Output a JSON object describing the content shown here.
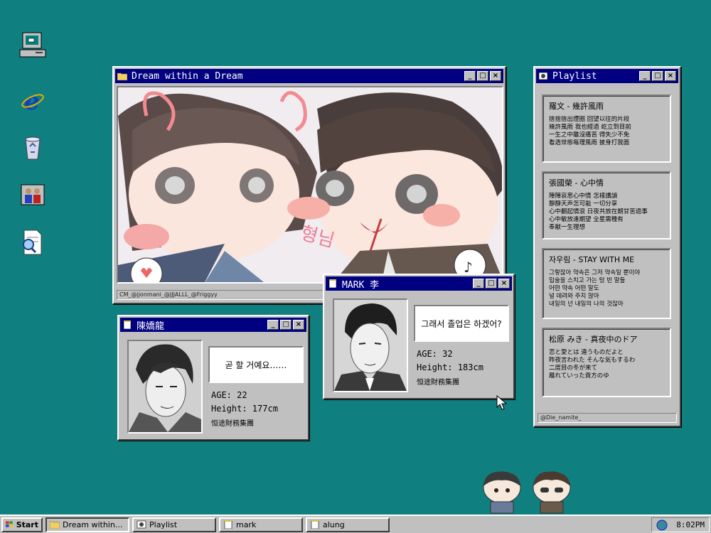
{
  "windows": {
    "dream": {
      "title": "Dream within a Dream",
      "status": "CM_@jjonmani_@JJJALLL_@Friggyy",
      "art_text": "형님"
    },
    "playlist": {
      "title": "Playlist",
      "status": "@Die_namite_",
      "songs": [
        {
          "title": "羅文 - 幾許風雨",
          "lyrics": [
            "捨捨捨出煙圈  回望以往的片段",
            "幾許風雨  我也經過  屹立到目前",
            "一生之中雖沒痛苦  得失少不免",
            "看透世態每理風雨  披身打我面"
          ]
        },
        {
          "title": "張國榮 - 心中情",
          "lyrics": [
            "陣陣哀思心中情  怎樣講讀",
            "靜靜天声怎可能  一切分享",
            "心中翻起情浪  日夜共放在期甘苦過事",
            "心中敏放逢期望  全星需種有",
            "奉献一生理想"
          ]
        },
        {
          "title": "자우림 - STAY WITH ME",
          "lyrics": [
            "그렇잖아 약속은 그저 약속일 뿐이야",
            "입술을 스치고 가는 텅 빈 말들",
            "어떤 약속 어떤 말도",
            "널 데려와 주지 않아",
            "내일의 넌 내일의 나의 것잖아"
          ]
        },
        {
          "title": "松原 みき - 真夜中のドア",
          "lyrics": [
            "恋と愛とは 違うものだよと",
            "昨夜言われた そんな気もするわ",
            "二度目の冬が来て",
            "離れていった貴方のゆ"
          ]
        }
      ]
    },
    "chen": {
      "title": "陳嬌龍",
      "speech": "곧 할 거예요……",
      "age": "AGE: 22",
      "height": "Height: 177cm",
      "org": "恒途財務集團"
    },
    "mark": {
      "title": "MARK 李",
      "speech": "그래서 졸업은 하겠어?",
      "age": "AGE: 32",
      "height": "Height: 183cm",
      "org": "恒途財務集團"
    }
  },
  "taskbar": {
    "start": "Start",
    "items": [
      "Dream within...",
      "Playlist",
      "mark",
      "alung"
    ],
    "clock": "8:02PM"
  },
  "icons": {
    "desktop": [
      "my-computer-icon",
      "internet-explorer-icon",
      "recycle-bin-icon",
      "network-people-icon",
      "document-search-icon"
    ]
  },
  "colors": {
    "desktop": "#0f7f7f",
    "titlebar": "#000080",
    "chrome": "#c0c0c0"
  }
}
